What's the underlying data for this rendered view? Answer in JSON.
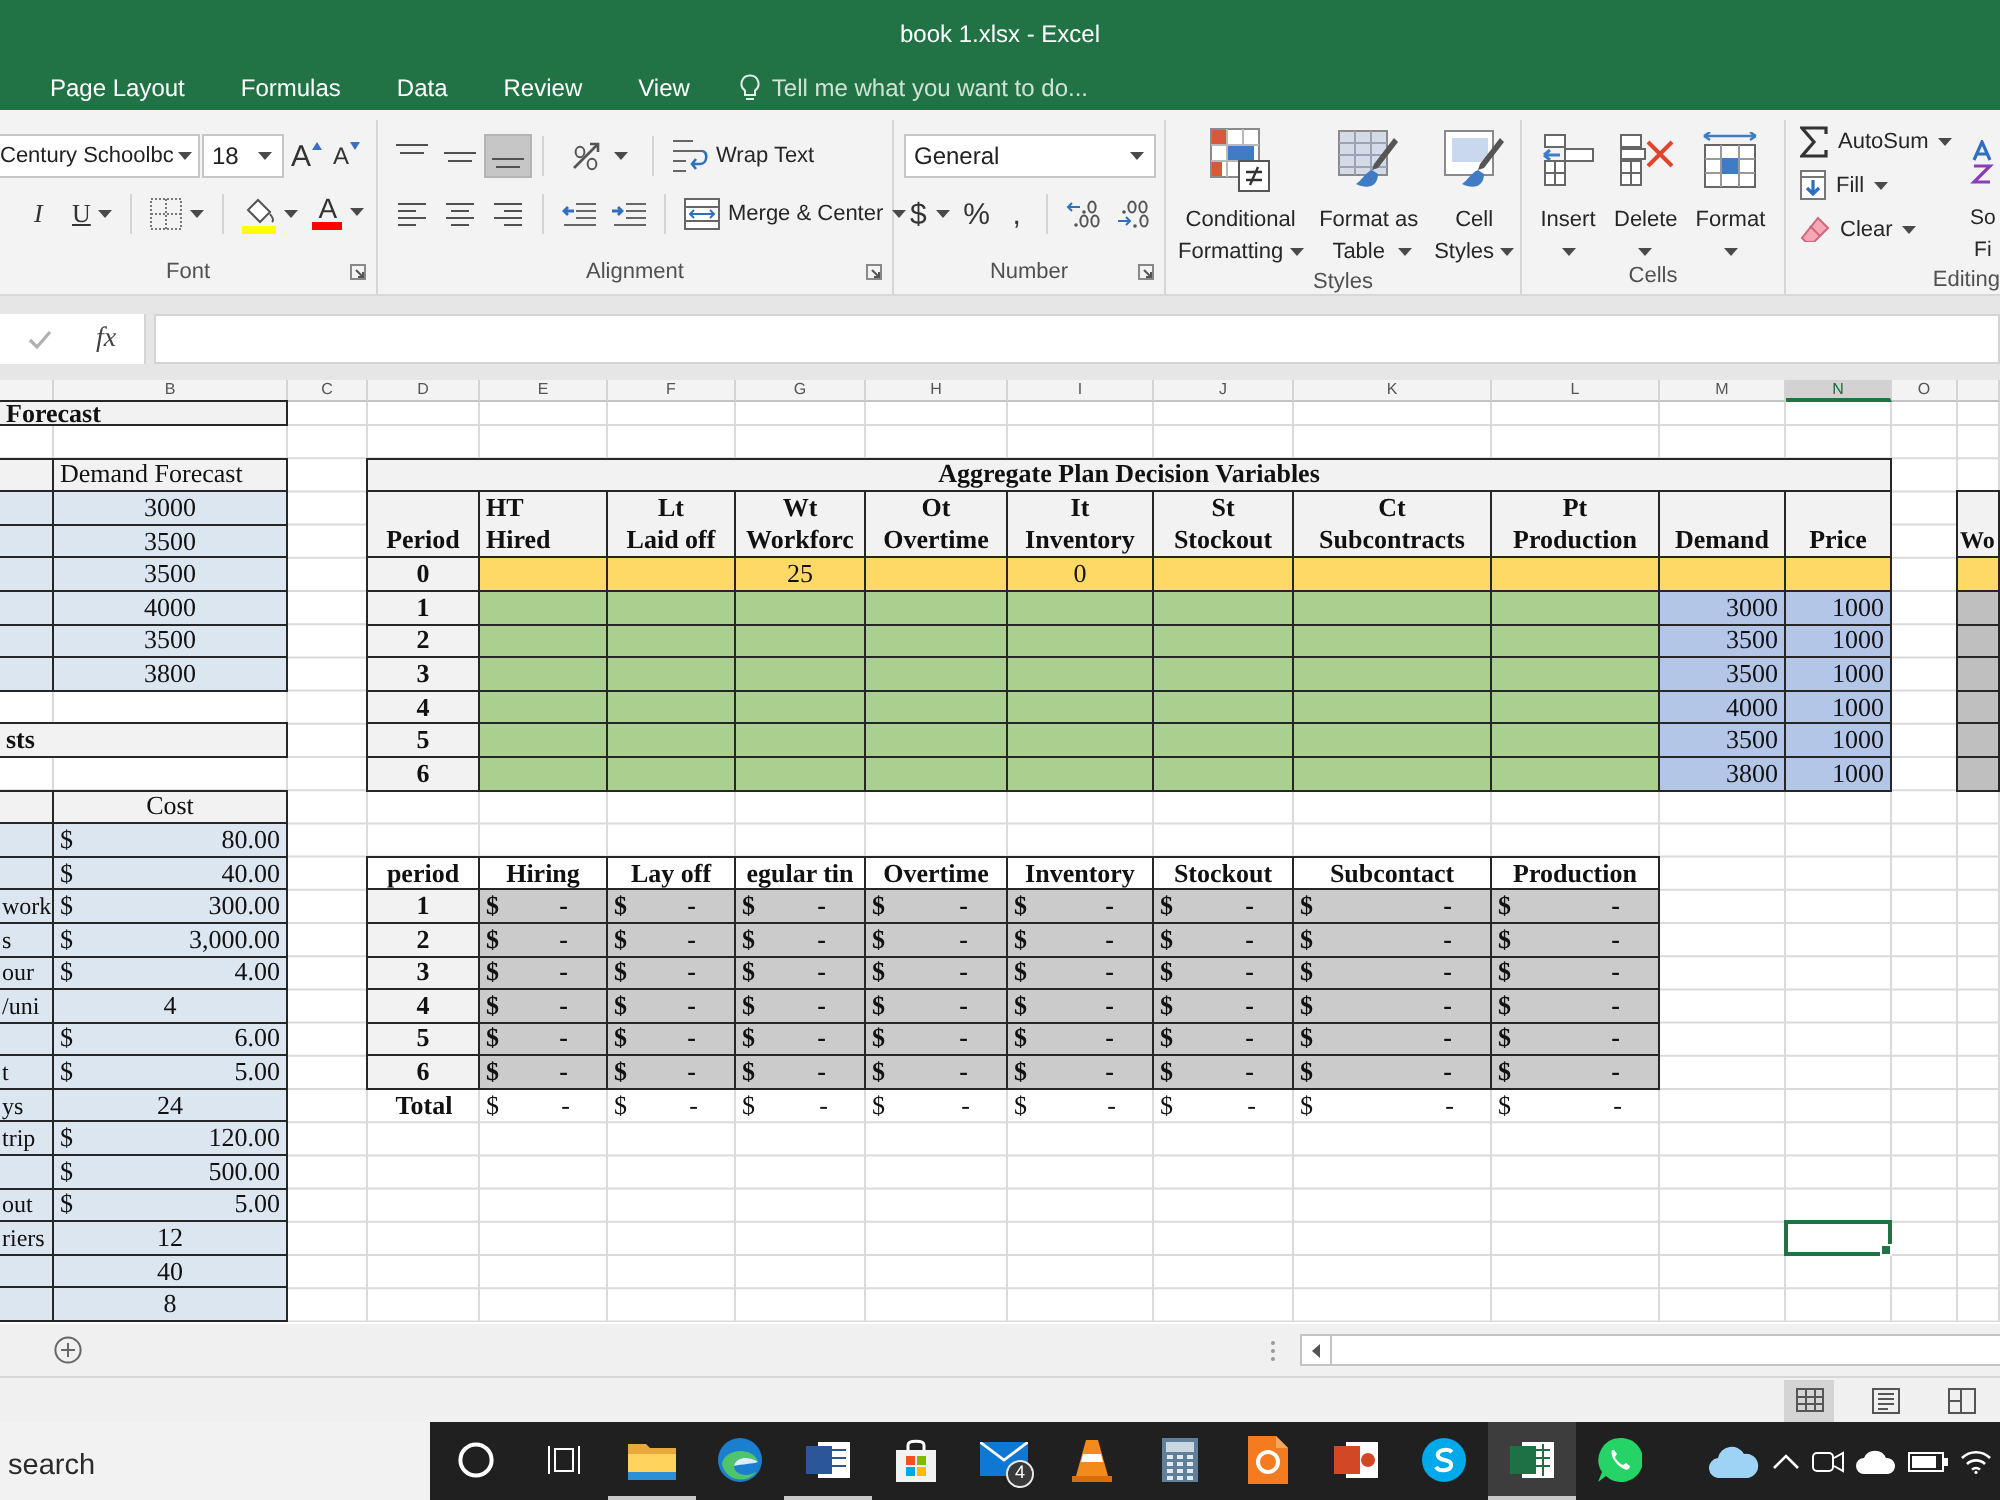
{
  "window": {
    "title": "book 1.xlsx - Excel"
  },
  "ribbon_tabs": [
    {
      "label": "Page Layout",
      "selected": false
    },
    {
      "label": "Formulas",
      "selected": false
    },
    {
      "label": "Data",
      "selected": false
    },
    {
      "label": "Review",
      "selected": false
    },
    {
      "label": "View",
      "selected": false
    }
  ],
  "tell_me": {
    "placeholder": "Tell me what you want to do..."
  },
  "font_group": {
    "label": "Font",
    "font_name": "Century Schoolbc",
    "font_size": "18",
    "grow_font": "A",
    "shrink_font": "A",
    "italic": {
      "label": "I",
      "on": false
    },
    "underline": {
      "label": "U",
      "on": false
    },
    "font_color": "A"
  },
  "alignment_group": {
    "label": "Alignment",
    "vertical_align": [
      {
        "kind": "top",
        "selected": false
      },
      {
        "kind": "middle",
        "selected": false
      },
      {
        "kind": "bottom",
        "selected": true
      }
    ],
    "horizontal_align": [
      {
        "kind": "left",
        "selected": false
      },
      {
        "kind": "center",
        "selected": false
      },
      {
        "kind": "right",
        "selected": false
      }
    ],
    "wrap_text": {
      "label": "Wrap Text",
      "on": false
    },
    "merge": {
      "label": "Merge & Center"
    }
  },
  "number_group": {
    "label": "Number",
    "format": "General",
    "currency": "$",
    "percent": "%",
    "comma": ","
  },
  "styles_group": {
    "label": "Styles",
    "buttons": [
      {
        "kind": "conditional",
        "lines": [
          "Conditional",
          "Formatting"
        ]
      },
      {
        "kind": "table",
        "lines": [
          "Format as",
          "Table"
        ]
      },
      {
        "kind": "cell-styles",
        "lines": [
          "Cell",
          "Styles"
        ]
      }
    ]
  },
  "cells_group": {
    "label": "Cells",
    "buttons": [
      {
        "kind": "insert",
        "label": "Insert"
      },
      {
        "kind": "delete",
        "label": "Delete"
      },
      {
        "kind": "format",
        "label": "Format"
      }
    ]
  },
  "editing_group": {
    "label": "Editing",
    "buttons": [
      {
        "kind": "sum",
        "label": "AutoSum"
      },
      {
        "kind": "fill",
        "label": "Fill"
      },
      {
        "kind": "clear",
        "label": "Clear"
      }
    ],
    "sort_lines": [
      "So",
      "Fi"
    ]
  },
  "formula_bar": {
    "function_label": "fx"
  },
  "sheet": {
    "column_headers": [
      {
        "letter": "B",
        "selected": false
      },
      {
        "letter": "C",
        "selected": false
      },
      {
        "letter": "D",
        "selected": false
      },
      {
        "letter": "E",
        "selected": false
      },
      {
        "letter": "F",
        "selected": false
      },
      {
        "letter": "G",
        "selected": false
      },
      {
        "letter": "H",
        "selected": false
      },
      {
        "letter": "I",
        "selected": false
      },
      {
        "letter": "J",
        "selected": false
      },
      {
        "letter": "K",
        "selected": false
      },
      {
        "letter": "L",
        "selected": false
      },
      {
        "letter": "M",
        "selected": false
      },
      {
        "letter": "N",
        "selected": true
      },
      {
        "letter": "O",
        "selected": false
      }
    ],
    "forecast": {
      "title": "Forecast",
      "header": "Demand Forecast",
      "values": [
        "3000",
        "3500",
        "3500",
        "4000",
        "3500",
        "3800"
      ]
    },
    "costs": {
      "title": "sts",
      "header": "Cost",
      "rows": [
        {
          "currency": "$",
          "amount": "80.00"
        },
        {
          "currency": "$",
          "amount": "40.00"
        },
        {
          "label": "work",
          "currency": "$",
          "amount": "300.00"
        },
        {
          "label": "s",
          "currency": "$",
          "amount": "3,000.00"
        },
        {
          "label": "our",
          "currency": "$",
          "amount": "4.00"
        },
        {
          "label": "/uni",
          "amount": "4"
        },
        {
          "currency": "$",
          "amount": "6.00"
        },
        {
          "label": "t",
          "currency": "$",
          "amount": "5.00"
        },
        {
          "label": "ys",
          "amount": "24"
        },
        {
          "label": "trip",
          "currency": "$",
          "amount": "120.00"
        },
        {
          "currency": "$",
          "amount": "500.00"
        },
        {
          "label": "out",
          "currency": "$",
          "amount": "5.00"
        },
        {
          "label": "riers",
          "amount": "12"
        },
        {
          "amount": "40"
        },
        {
          "amount": "8"
        }
      ]
    },
    "plan": {
      "title": "Aggregate Plan Decision Variables",
      "columns": [
        {
          "lines": [
            "Period"
          ]
        },
        {
          "lines": [
            "HT",
            "Hired"
          ]
        },
        {
          "lines": [
            "Lt",
            "Laid off"
          ]
        },
        {
          "lines": [
            "Wt",
            "Workforc"
          ]
        },
        {
          "lines": [
            "Ot",
            "Overtime"
          ]
        },
        {
          "lines": [
            "It",
            "Inventory"
          ]
        },
        {
          "lines": [
            "St",
            "Stockout"
          ]
        },
        {
          "lines": [
            "Ct",
            "Subcontracts"
          ]
        },
        {
          "lines": [
            "Pt",
            "Production"
          ]
        },
        {
          "lines": [
            "Demand"
          ]
        },
        {
          "lines": [
            "Price"
          ]
        }
      ],
      "rows": [
        {
          "kind": "initial",
          "cells": [
            "0",
            "",
            "",
            "25",
            "",
            "0",
            "",
            "",
            "",
            "",
            ""
          ]
        },
        {
          "kind": "variable",
          "cells": [
            "1",
            "",
            "",
            "",
            "",
            "",
            "",
            "",
            "",
            "3000",
            "1000"
          ]
        },
        {
          "kind": "variable",
          "cells": [
            "2",
            "",
            "",
            "",
            "",
            "",
            "",
            "",
            "",
            "3500",
            "1000"
          ]
        },
        {
          "kind": "variable",
          "cells": [
            "3",
            "",
            "",
            "",
            "",
            "",
            "",
            "",
            "",
            "3500",
            "1000"
          ]
        },
        {
          "kind": "variable",
          "cells": [
            "4",
            "",
            "",
            "",
            "",
            "",
            "",
            "",
            "",
            "4000",
            "1000"
          ]
        },
        {
          "kind": "variable",
          "cells": [
            "5",
            "",
            "",
            "",
            "",
            "",
            "",
            "",
            "",
            "3500",
            "1000"
          ]
        },
        {
          "kind": "variable",
          "cells": [
            "6",
            "",
            "",
            "",
            "",
            "",
            "",
            "",
            "",
            "3800",
            "1000"
          ]
        }
      ]
    },
    "side_table": {
      "header": "Wo"
    },
    "cost_summary": {
      "columns": [
        "period",
        "Hiring",
        "Lay off",
        "egular tin",
        "Overtime",
        "Inventory",
        "Stockout",
        "Subcontact",
        "Production"
      ],
      "rows": [
        {
          "kind": "period",
          "cells": [
            {
              "value": "1"
            },
            {
              "currency": "$",
              "amount": "-"
            },
            {
              "currency": "$",
              "amount": "-"
            },
            {
              "currency": "$",
              "amount": "-"
            },
            {
              "currency": "$",
              "amount": "-"
            },
            {
              "currency": "$",
              "amount": "-"
            },
            {
              "currency": "$",
              "amount": "-"
            },
            {
              "currency": "$",
              "amount": "-"
            },
            {
              "currency": "$",
              "amount": "-"
            }
          ]
        },
        {
          "kind": "period",
          "cells": [
            {
              "value": "2"
            },
            {
              "currency": "$",
              "amount": "-"
            },
            {
              "currency": "$",
              "amount": "-"
            },
            {
              "currency": "$",
              "amount": "-"
            },
            {
              "currency": "$",
              "amount": "-"
            },
            {
              "currency": "$",
              "amount": "-"
            },
            {
              "currency": "$",
              "amount": "-"
            },
            {
              "currency": "$",
              "amount": "-"
            },
            {
              "currency": "$",
              "amount": "-"
            }
          ]
        },
        {
          "kind": "period",
          "cells": [
            {
              "value": "3"
            },
            {
              "currency": "$",
              "amount": "-"
            },
            {
              "currency": "$",
              "amount": "-"
            },
            {
              "currency": "$",
              "amount": "-"
            },
            {
              "currency": "$",
              "amount": "-"
            },
            {
              "currency": "$",
              "amount": "-"
            },
            {
              "currency": "$",
              "amount": "-"
            },
            {
              "currency": "$",
              "amount": "-"
            },
            {
              "currency": "$",
              "amount": "-"
            }
          ]
        },
        {
          "kind": "period",
          "cells": [
            {
              "value": "4"
            },
            {
              "currency": "$",
              "amount": "-"
            },
            {
              "currency": "$",
              "amount": "-"
            },
            {
              "currency": "$",
              "amount": "-"
            },
            {
              "currency": "$",
              "amount": "-"
            },
            {
              "currency": "$",
              "amount": "-"
            },
            {
              "currency": "$",
              "amount": "-"
            },
            {
              "currency": "$",
              "amount": "-"
            },
            {
              "currency": "$",
              "amount": "-"
            }
          ]
        },
        {
          "kind": "period",
          "cells": [
            {
              "value": "5"
            },
            {
              "currency": "$",
              "amount": "-"
            },
            {
              "currency": "$",
              "amount": "-"
            },
            {
              "currency": "$",
              "amount": "-"
            },
            {
              "currency": "$",
              "amount": "-"
            },
            {
              "currency": "$",
              "amount": "-"
            },
            {
              "currency": "$",
              "amount": "-"
            },
            {
              "currency": "$",
              "amount": "-"
            },
            {
              "currency": "$",
              "amount": "-"
            }
          ]
        },
        {
          "kind": "period",
          "cells": [
            {
              "value": "6"
            },
            {
              "currency": "$",
              "amount": "-"
            },
            {
              "currency": "$",
              "amount": "-"
            },
            {
              "currency": "$",
              "amount": "-"
            },
            {
              "currency": "$",
              "amount": "-"
            },
            {
              "currency": "$",
              "amount": "-"
            },
            {
              "currency": "$",
              "amount": "-"
            },
            {
              "currency": "$",
              "amount": "-"
            },
            {
              "currency": "$",
              "amount": "-"
            }
          ]
        },
        {
          "kind": "total",
          "cells": [
            {
              "value": "Total"
            },
            {
              "currency": "$",
              "amount": "-"
            },
            {
              "currency": "$",
              "amount": "-"
            },
            {
              "currency": "$",
              "amount": "-"
            },
            {
              "currency": "$",
              "amount": "-"
            },
            {
              "currency": "$",
              "amount": "-"
            },
            {
              "currency": "$",
              "amount": "-"
            },
            {
              "currency": "$",
              "amount": "-"
            },
            {
              "currency": "$",
              "amount": "-"
            }
          ]
        }
      ]
    }
  },
  "status_bar": {
    "views": [
      {
        "kind": "normal",
        "selected": true
      },
      {
        "kind": "page-layout",
        "selected": false
      },
      {
        "kind": "page-break",
        "selected": false
      }
    ]
  },
  "taskbar": {
    "search": {
      "placeholder": "search"
    },
    "apps": [
      {
        "kind": "circle",
        "running": false,
        "selected": false
      },
      {
        "kind": "task-view",
        "running": false,
        "selected": false
      },
      {
        "kind": "folder",
        "running": true,
        "selected": false
      },
      {
        "kind": "browser",
        "running": false,
        "selected": false
      },
      {
        "kind": "word",
        "running": true,
        "selected": false
      },
      {
        "kind": "store",
        "running": false,
        "selected": false
      },
      {
        "kind": "mail",
        "running": false,
        "selected": false,
        "badge": "4"
      },
      {
        "kind": "cone",
        "running": false,
        "selected": false
      },
      {
        "kind": "calculator",
        "running": false,
        "selected": false
      },
      {
        "kind": "pdf",
        "running": false,
        "selected": false
      },
      {
        "kind": "slides",
        "running": false,
        "selected": false
      },
      {
        "kind": "chat",
        "running": false,
        "selected": false
      },
      {
        "kind": "spreadsheet",
        "running": true,
        "selected": true
      },
      {
        "kind": "phone-chat",
        "running": false,
        "selected": false
      }
    ]
  }
}
